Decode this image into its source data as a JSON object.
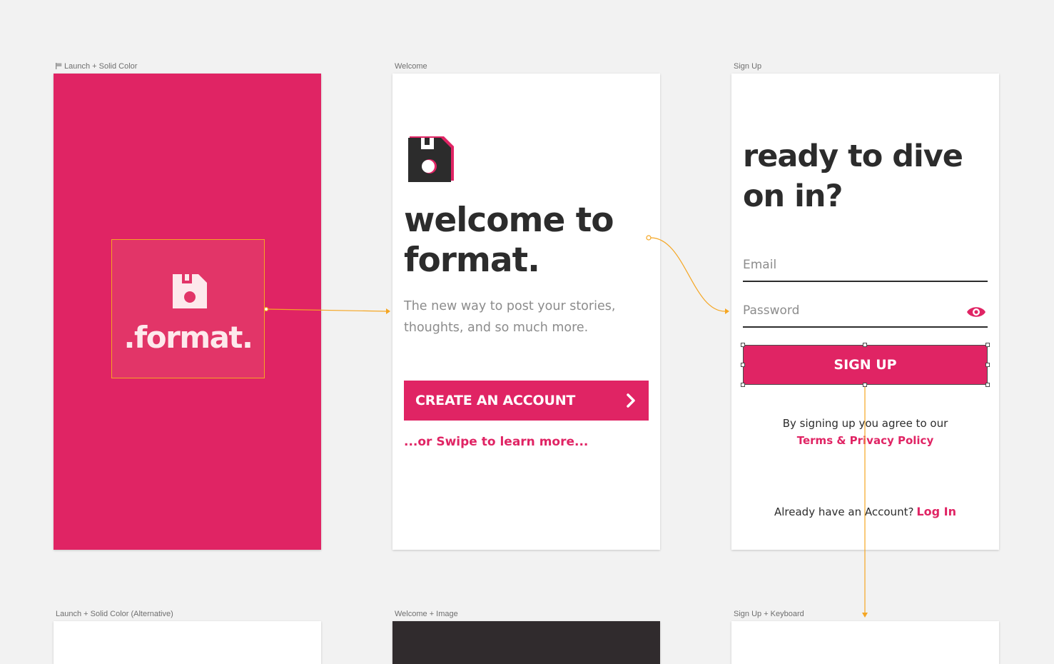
{
  "colors": {
    "brand": "#e02464",
    "dark": "#2c2c2c",
    "connector": "#f5a623",
    "canvas": "#f2f2f2"
  },
  "artboards": {
    "launch": {
      "label": "Launch + Solid Color",
      "logo_text": ".format.",
      "logo_icon": "floppy-disk-icon"
    },
    "welcome": {
      "label": "Welcome",
      "title": "welcome to format.",
      "subtitle": "The new way to post your stories, thoughts, and so much more.",
      "cta_label": "CREATE AN ACCOUNT",
      "swipe_text": "...or Swipe to learn more..."
    },
    "signup": {
      "label": "Sign Up",
      "title": "ready to dive on in?",
      "email_placeholder": "Email",
      "password_placeholder": "Password",
      "button_label": "SIGN UP",
      "agree_text": "By signing up you agree to our",
      "terms_text": "Terms & Privacy Policy",
      "have_account_text": "Already have an Account?",
      "login_text": "Log In"
    },
    "launch_alt": {
      "label": "Launch + Solid Color (Alternative)"
    },
    "welcome_image": {
      "label": "Welcome + Image"
    },
    "signup_keyboard": {
      "label": "Sign Up + Keyboard"
    }
  }
}
